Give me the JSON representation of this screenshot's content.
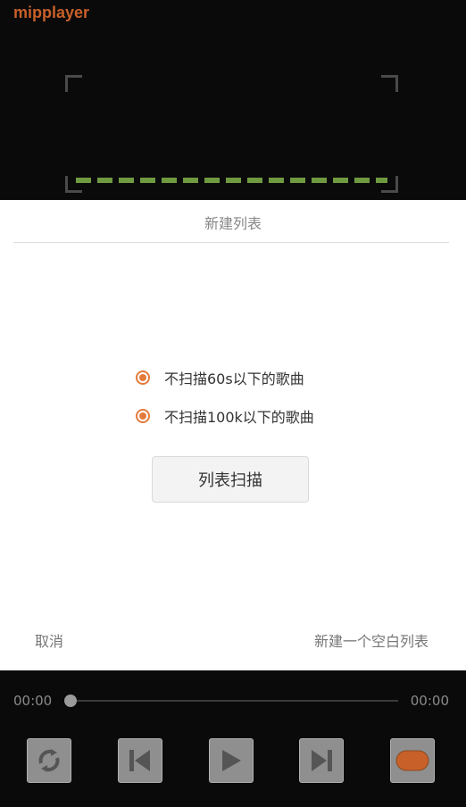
{
  "app": {
    "title": "mipplayer"
  },
  "dialog": {
    "title": "新建列表",
    "options": [
      {
        "label": "不扫描60s以下的歌曲",
        "checked": true
      },
      {
        "label": "不扫描100k以下的歌曲",
        "checked": true
      }
    ],
    "scan_button": "列表扫描",
    "cancel_button": "取消",
    "new_empty_button": "新建一个空白列表"
  },
  "player": {
    "current_time": "00:00",
    "total_time": "00:00",
    "progress": 0,
    "controls": [
      "repeat-icon",
      "previous-icon",
      "play-icon",
      "next-icon",
      "playlist-icon"
    ]
  },
  "colors": {
    "accent": "#e47a3c",
    "title": "#c8602a",
    "scan_line": "#6f9a40"
  }
}
